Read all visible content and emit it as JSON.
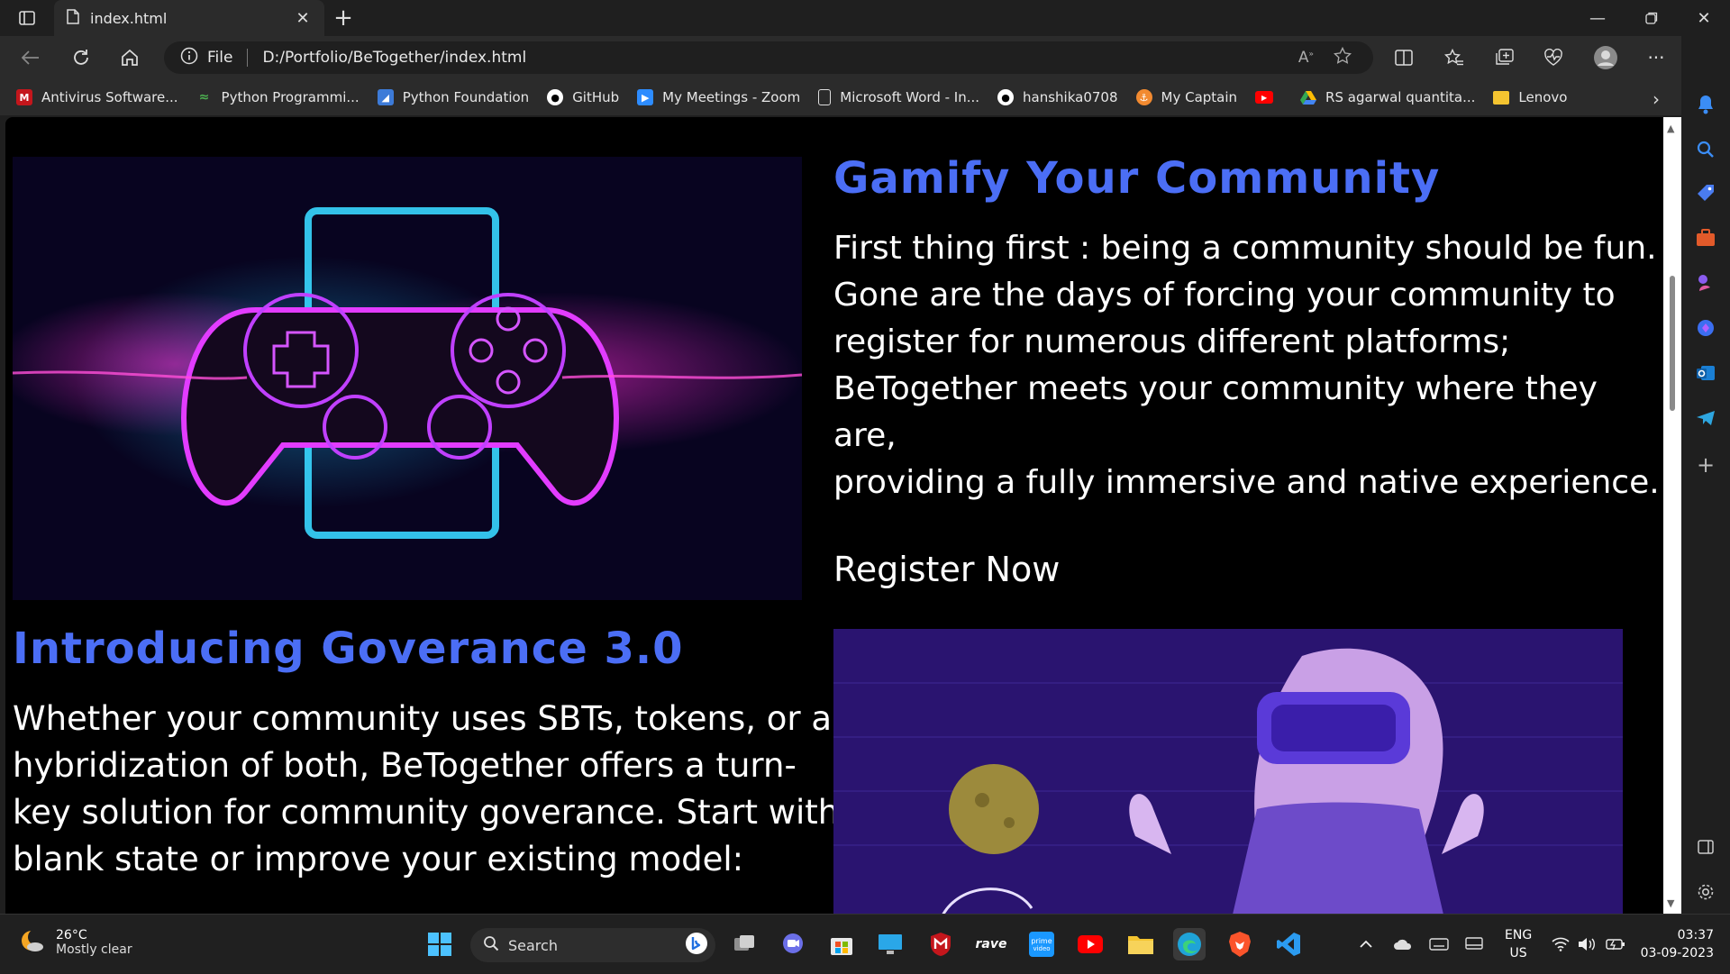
{
  "browser": {
    "tab_title": "index.html",
    "address_label": "File",
    "url": "D:/Portfolio/BeTogether/index.html"
  },
  "favorites": [
    {
      "label": "Antivirus Software...",
      "color": "#c4161c",
      "icon": "mcafee-icon"
    },
    {
      "label": "Python Programmi...",
      "color": "#4caf50",
      "icon": "python-programming-icon"
    },
    {
      "label": "Python Foundation",
      "color": "#3d7bd8",
      "icon": "python-foundation-icon"
    },
    {
      "label": "GitHub",
      "color": "#ffffff",
      "icon": "github-icon"
    },
    {
      "label": "My Meetings - Zoom",
      "color": "#2d8cff",
      "icon": "zoom-icon"
    },
    {
      "label": "Microsoft Word - In...",
      "color": "#ffffff",
      "icon": "document-icon"
    },
    {
      "label": "hanshika0708",
      "color": "#ffffff",
      "icon": "github-icon"
    },
    {
      "label": "My Captain",
      "color": "#f28a30",
      "icon": "mycaptain-icon"
    },
    {
      "label": "",
      "color": "#ff0000",
      "icon": "youtube-icon"
    },
    {
      "label": "RS agarwal quantita...",
      "color": "#34a853",
      "icon": "google-drive-icon"
    },
    {
      "label": "Lenovo",
      "color": "#f4c430",
      "icon": "folder-icon"
    }
  ],
  "page": {
    "section1_title": "Gamify Your Community",
    "section1_lines": [
      "First thing first : being a community should be fun.",
      "Gone are the days of forcing your community to",
      "register for numerous different platforms;",
      "BeTogether meets your community where they are,",
      "providing a fully immersive and native experience."
    ],
    "register_link": "Register Now",
    "section2_title": "Introducing Goverance 3.0",
    "section2_lines": [
      "Whether your community uses SBTs, tokens, or a",
      "hybridization of both, BeTogether offers a turn-",
      "key solution for community goverance. Start with a",
      "blank state or improve your existing model:"
    ]
  },
  "taskbar": {
    "temperature": "26°C",
    "weather": "Mostly clear",
    "search_label": "Search",
    "lang_top": "ENG",
    "lang_bottom": "US",
    "time": "03:37",
    "date": "03-09-2023"
  },
  "colors": {
    "heading": "#4b6ef5",
    "page_bg": "#000000",
    "browser_bg": "#1f1f1f"
  }
}
